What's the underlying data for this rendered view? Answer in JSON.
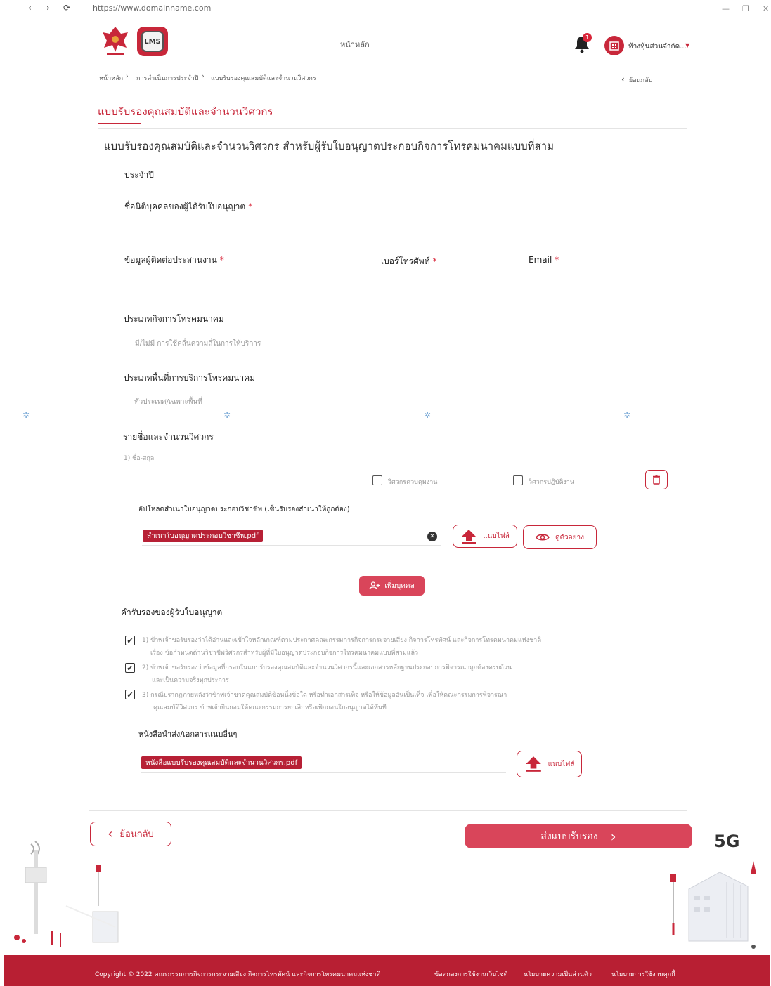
{
  "browser": {
    "url": "https://www.domainname.com",
    "back": "‹",
    "forward": "›",
    "reload": "⟳"
  },
  "header": {
    "logo2_text": "LMS",
    "home_link": "หน้าหลัก",
    "notification_count": "1",
    "company_name": "ห้างหุ้นส่วนจำกัด..."
  },
  "breadcrumb": {
    "items": [
      "หน้าหลัก",
      "การดำเนินการประจำปี",
      "แบบรับรองคุณสมบัติและจำนวนวิศวกร"
    ],
    "separator": "›",
    "back_label": "ย้อนกลับ"
  },
  "page": {
    "title": "แบบรับรองคุณสมบัติและจำนวนวิศวกร",
    "subtitle": "แบบรับรองคุณสมบัติและจำนวนวิศวกร สำหรับผู้รับใบอนุญาตประกอบกิจการโทรคมนาคมแบบที่สาม",
    "year_label": "ประจำปี"
  },
  "form": {
    "licensee_name_label": "ชื่อนิติบุคคลของผู้ได้รับใบอนุญาต",
    "coordinator_label": "ข้อมูลผู้ติดต่อประสานงาน",
    "phone_label": "เบอร์โทรศัพท์",
    "email_label": "Email",
    "required_mark": "*",
    "business_type_label": "ประเภทกิจการโทรคมนาคม",
    "business_type_value": "มี/ไม่มี การใช้คลื่นความถี่ในการให้บริการ",
    "service_area_label": "ประเภทพื้นที่การบริการโทรคมนาคม",
    "service_area_value": "ทั่วประเทศ/เฉพาะพื้นที่",
    "engineers_label": "รายชื่อและจำนวนวิศวกร",
    "engineer_1": "1) ชื่อ-สกุล",
    "control_engineer_label": "วิศวกรควบคุมงาน",
    "practice_engineer_label": "วิศวกรปฏิบัติงาน",
    "upload_license_label": "อัปโหลดสำเนาใบอนุญาตประกอบวิชาชีพ (เซ็นรับรองสำเนาให้ถูกต้อง)",
    "license_file": "สำเนาใบอนุญาตประกอบวิชาชีพ.pdf",
    "attach_file_label": "แนบไฟล์",
    "view_example_label": "ดูตัวอย่าง",
    "add_person_label": "เพิ่มบุคคล"
  },
  "certification": {
    "heading": "คำรับรองของผู้รับใบอนุญาต",
    "items": [
      {
        "line1": "1) ข้าพเจ้าขอรับรองว่าได้อ่านและเข้าใจหลักเกณฑ์ตามประกาศคณะกรรมการกิจการกระจายเสียง กิจการโทรทัศน์ และกิจการโทรคมนาคมแห่งชาติ",
        "line2": "เรื่อง ข้อกำหนดด้านวิชาชีพวิศวกรสำหรับผู้ที่มีใบอนุญาตประกอบกิจการโทรคมนาคมแบบที่สามแล้ว"
      },
      {
        "line1": "2) ข้าพเจ้าขอรับรองว่าข้อมูลที่กรอกในแบบรับรองคุณสมบัติและจำนวนวิศวกรนี้และเอกสารหลักฐานประกอบการพิจารณาถูกต้องครบถ้วน",
        "line2": "และเป็นความจริงทุกประการ"
      },
      {
        "line1": "3) กรณีปรากฏภายหลังว่าข้าพเจ้าขาดคุณสมบัติข้อหนึ่งข้อใด หรือทำเอกสารเท็จ หรือให้ข้อมูลอันเป็นเท็จ เพื่อให้คณะกรรมการพิจารณา",
        "line2": "คุณสมบัติวิศวกร ข้าพเจ้ายินยอมให้คณะกรรมการยกเลิกหรือเพิกถอนใบอนุญาตได้ทันที"
      }
    ],
    "other_docs_label": "หนังสือนำส่ง/เอกสารแนบอื่นๆ",
    "other_docs_file": "หนังสือแบบรับรองคุณสมบัติและจำนวนวิศวกร.pdf",
    "attach_file_label": "แนบไฟล์"
  },
  "actions": {
    "back_label": "ย้อนกลับ",
    "submit_label": "ส่งแบบรับรอง",
    "fiveg_text": "5G"
  },
  "footer": {
    "copyright": "Copyright © 2022 คณะกรรมการกิจการกระจายเสียง กิจการโทรทัศน์ และกิจการโทรคมนาคมแห่งชาติ",
    "links": [
      "ข้อตกลงการใช้งานเว็บไซต์",
      "นโยบายความเป็นส่วนตัว",
      "นโยบายการใช้งานคุกกี้"
    ]
  },
  "colors": {
    "primary": "#c8273a",
    "button_fill": "#d9455a",
    "footer_bg": "#b81f33"
  }
}
